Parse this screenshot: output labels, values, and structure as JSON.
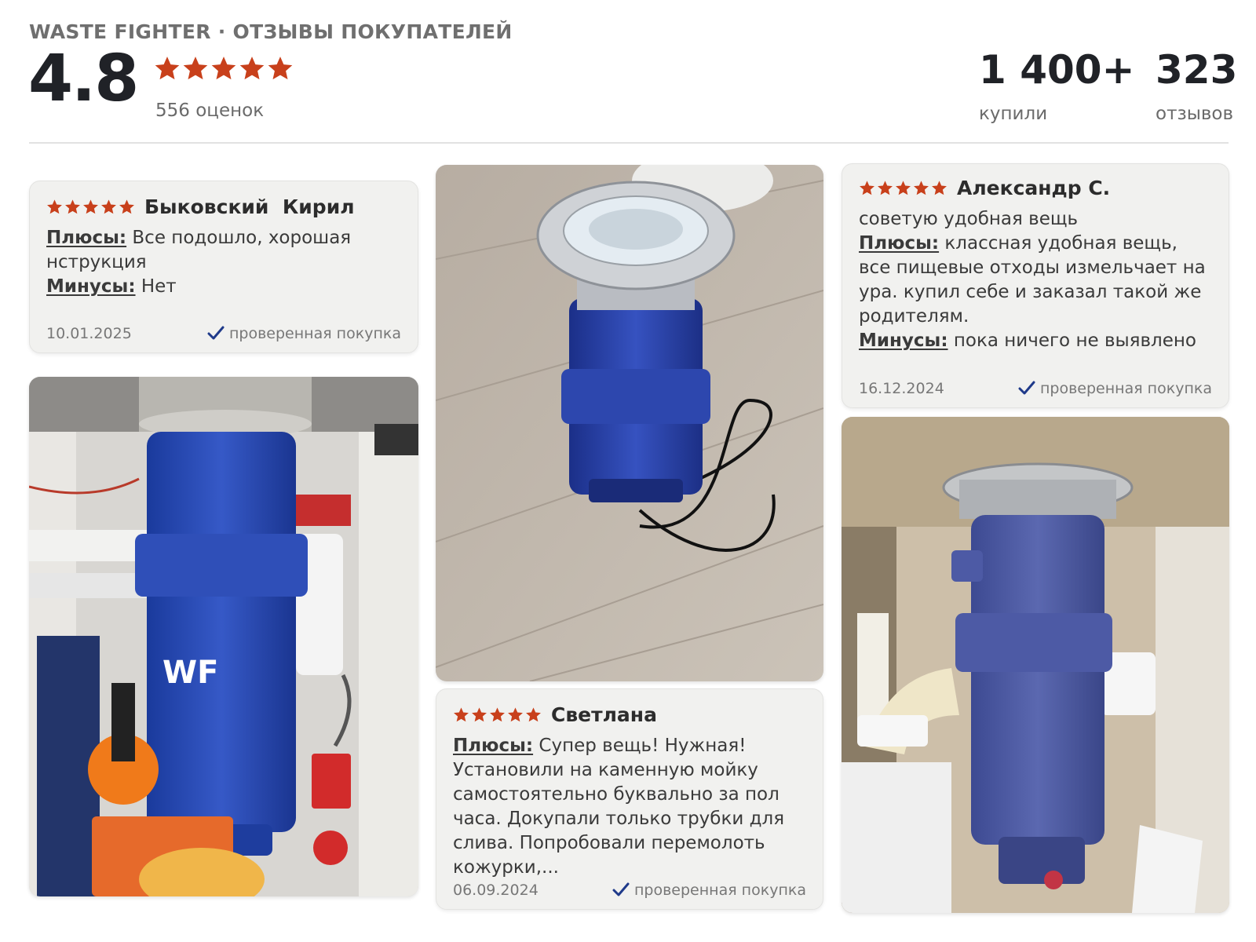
{
  "header": {
    "brand": "WASTE FIGHTER · ОТЗЫВЫ ПОКУПАТЕЛЕЙ",
    "rating": "4.8",
    "stars": 5,
    "ratings_count": "556 оценок",
    "bought_value": "1 400+",
    "bought_label": "купили",
    "reviews_value": "323",
    "reviews_label": "отзывов"
  },
  "colors": {
    "star": "#c8401b",
    "verified_check": "#1f3a8a",
    "card_bg": "#f1f1ef"
  },
  "reviews": [
    {
      "stars": 5,
      "name": "Быковский  Кирил",
      "intro": "",
      "pros_label": "Плюсы:",
      "pros": "Все подошло, хорошая нструкция",
      "cons_label": "Минусы:",
      "cons": "Нет",
      "date": "10.01.2025",
      "verified": "проверенная покупка"
    },
    {
      "stars": 5,
      "name": "Светлана",
      "intro": "",
      "pros_label": "Плюсы:",
      "pros": "Супер вещь! Нужная! Установили на каменную мойку самостоятельно буквально за пол часа. Докупали только трубки для слива. Попробовали перемолоть кожурки,...",
      "cons_label": "",
      "cons": "",
      "date": "06.09.2024",
      "verified": "проверенная покупка"
    },
    {
      "stars": 5,
      "name": "Александр С.",
      "intro": "советую удобная вещь",
      "pros_label": "Плюсы:",
      "pros": "классная удобная вещь, все пищевые отходы измельчает на ура. купил себе и заказал такой же родителям.",
      "cons_label": "Минусы:",
      "cons": "пока ничего не выявлено",
      "date": "16.12.2024",
      "verified": "проверенная покупка"
    }
  ],
  "photos": [
    {
      "alt": "Измельчитель под мойкой"
    },
    {
      "alt": "Измельчитель на полу"
    },
    {
      "alt": "Установленный измельчитель"
    }
  ]
}
